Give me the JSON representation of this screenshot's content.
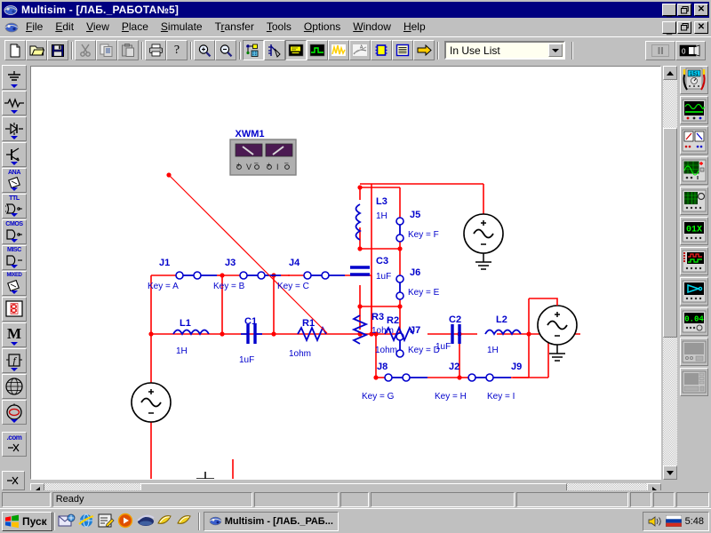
{
  "window": {
    "title": "Multisim - [ЛАБ._РАБОТА№5]",
    "app_icon": "multisim-icon",
    "minimize_label": "_",
    "maximize_label": "❐",
    "close_label": "✕"
  },
  "menubar": {
    "mdi_icon": "mdi-document-icon",
    "items": [
      {
        "label": "File",
        "accel": "F"
      },
      {
        "label": "Edit",
        "accel": "E"
      },
      {
        "label": "View",
        "accel": "V"
      },
      {
        "label": "Place",
        "accel": "P"
      },
      {
        "label": "Simulate",
        "accel": "S"
      },
      {
        "label": "Transfer",
        "accel": "r"
      },
      {
        "label": "Tools",
        "accel": "T"
      },
      {
        "label": "Options",
        "accel": "O"
      },
      {
        "label": "Window",
        "accel": "W"
      },
      {
        "label": "Help",
        "accel": "H"
      }
    ],
    "mdi_buttons": [
      "_",
      "❐",
      "✕"
    ]
  },
  "toolbar": {
    "buttons": [
      {
        "name": "new-file-button",
        "icon": "new-document-icon"
      },
      {
        "name": "open-file-button",
        "icon": "open-folder-icon"
      },
      {
        "name": "save-file-button",
        "icon": "floppy-disk-icon"
      },
      {
        "name": "cut-button",
        "icon": "scissors-icon"
      },
      {
        "name": "copy-button",
        "icon": "copy-icon"
      },
      {
        "name": "paste-button",
        "icon": "clipboard-icon"
      },
      {
        "name": "print-button",
        "icon": "printer-icon"
      },
      {
        "name": "help-button",
        "icon": "question-mark-icon"
      },
      {
        "name": "zoom-in-button",
        "icon": "magnifier-plus-icon"
      },
      {
        "name": "zoom-out-button",
        "icon": "magnifier-minus-icon"
      },
      {
        "name": "component-browser-button",
        "icon": "component-database-icon"
      },
      {
        "name": "netlist-button",
        "icon": "pin-tool-icon"
      },
      {
        "name": "properties-button",
        "icon": "yellow-panel-icon"
      },
      {
        "name": "oscilloscope-button",
        "icon": "green-waveform-icon"
      },
      {
        "name": "analysis-button",
        "icon": "yellow-graph-icon"
      },
      {
        "name": "postprocessor-button",
        "icon": "text-graph-icon"
      },
      {
        "name": "ic-button",
        "icon": "blue-chip-icon"
      },
      {
        "name": "list-button",
        "icon": "yellow-list-icon"
      },
      {
        "name": "transfer-button",
        "icon": "yellow-arrow-icon"
      }
    ],
    "in_use_list": {
      "value": "In Use List",
      "arrow": "▼"
    },
    "pause_button": {
      "name": "pause-simulation-button",
      "icon": "pause-icon"
    },
    "run_button": {
      "name": "run-simulation-button",
      "icon": "power-switch-icon"
    }
  },
  "component_palette": {
    "items": [
      {
        "name": "sources-palette-button",
        "icon": "ground-source-icon",
        "label": ""
      },
      {
        "name": "basic-palette-button",
        "icon": "resistor-icon",
        "label": ""
      },
      {
        "name": "diodes-palette-button",
        "icon": "diode-icon",
        "label": ""
      },
      {
        "name": "transistors-palette-button",
        "icon": "transistor-icon",
        "label": ""
      },
      {
        "name": "analog-palette-button",
        "icon": "opamp-icon",
        "label": "ANA"
      },
      {
        "name": "ttl-palette-button",
        "icon": "logic-gate-icon",
        "label": "TTL"
      },
      {
        "name": "cmos-palette-button",
        "icon": "logic-gate-icon",
        "label": "CMOS"
      },
      {
        "name": "misc-digital-palette-button",
        "icon": "logic-gate-icon",
        "label": "MISC"
      },
      {
        "name": "mixed-palette-button",
        "icon": "mixed-chip-icon",
        "label": "MIXED"
      },
      {
        "name": "indicators-palette-button",
        "icon": "seven-segment-icon",
        "label": ""
      },
      {
        "name": "misc-palette-button",
        "icon": "letter-m-icon",
        "label": ""
      },
      {
        "name": "controls-palette-button",
        "icon": "function-block-icon",
        "label": ""
      },
      {
        "name": "rf-palette-button",
        "icon": "rf-globe-icon",
        "label": ""
      },
      {
        "name": "electromech-palette-button",
        "icon": "motor-icon",
        "label": ""
      },
      {
        "name": "edu-palette-button",
        "icon": "dot-com-icon",
        "label": ".com"
      }
    ]
  },
  "instruments_palette": {
    "items": [
      {
        "name": "multimeter-button",
        "icon": "multimeter-icon"
      },
      {
        "name": "function-generator-button",
        "icon": "function-generator-icon"
      },
      {
        "name": "wattmeter-button",
        "icon": "wattmeter-icon"
      },
      {
        "name": "oscilloscope-instrument-button",
        "icon": "oscilloscope-icon"
      },
      {
        "name": "bode-plotter-button",
        "icon": "bode-plotter-icon"
      },
      {
        "name": "word-generator-button",
        "icon": "word-generator-icon"
      },
      {
        "name": "logic-analyzer-button",
        "icon": "logic-analyzer-icon"
      },
      {
        "name": "logic-converter-button",
        "icon": "logic-converter-icon"
      },
      {
        "name": "distortion-analyzer-button",
        "icon": "distortion-analyzer-icon"
      },
      {
        "name": "spectrum-analyzer-button",
        "icon": "spectrum-analyzer-icon"
      },
      {
        "name": "network-analyzer-button",
        "icon": "network-analyzer-icon"
      }
    ]
  },
  "schematic": {
    "instrument": {
      "label": "XWM1",
      "name": "wattmeter-xwm1",
      "terminal_marks": [
        "+",
        "V",
        "−",
        "+",
        "I",
        "−"
      ]
    },
    "colors": {
      "wire": "#ff0000",
      "component": "#0000cc",
      "label": "#0000cc",
      "outline": "#000000"
    },
    "components": [
      {
        "ref": "L1",
        "value": "1H",
        "type": "inductor"
      },
      {
        "ref": "C1",
        "value": "1uF",
        "type": "capacitor"
      },
      {
        "ref": "R1",
        "value": "1ohm",
        "type": "resistor"
      },
      {
        "ref": "R2",
        "value": "1ohm",
        "type": "resistor"
      },
      {
        "ref": "C2",
        "value": "1uF",
        "type": "capacitor"
      },
      {
        "ref": "L2",
        "value": "1H",
        "type": "inductor"
      },
      {
        "ref": "L3",
        "value": "1H",
        "type": "inductor"
      },
      {
        "ref": "C3",
        "value": "1uF",
        "type": "capacitor"
      },
      {
        "ref": "R3",
        "value": "1ohm",
        "type": "resistor"
      }
    ],
    "switches": [
      {
        "ref": "J1",
        "key": "Key = A"
      },
      {
        "ref": "J3",
        "key": "Key = B"
      },
      {
        "ref": "J4",
        "key": "Key = C"
      },
      {
        "ref": "J7",
        "key": "Key = D"
      },
      {
        "ref": "J6",
        "key": "Key = E"
      },
      {
        "ref": "J5",
        "key": "Key = F"
      },
      {
        "ref": "J8",
        "key": "Key = G"
      },
      {
        "ref": "J2",
        "key": "Key = H"
      },
      {
        "ref": "J9",
        "key": "Key = I"
      }
    ],
    "sources": [
      {
        "name": "ac-source-left",
        "symbol": "~"
      },
      {
        "name": "ac-source-right",
        "symbol": "~"
      },
      {
        "name": "ac-source-top",
        "symbol": "~"
      }
    ],
    "grounds": [
      {
        "name": "ground-left"
      },
      {
        "name": "ground-right"
      },
      {
        "name": "ground-top"
      }
    ]
  },
  "statusbar": {
    "message": "Ready",
    "panels": [
      "",
      "",
      "",
      "",
      "",
      ""
    ]
  },
  "taskbar": {
    "start_label": "Пуск",
    "quick_launch": [
      {
        "name": "outlook-express-icon"
      },
      {
        "name": "internet-explorer-icon"
      },
      {
        "name": "notepad-icon"
      },
      {
        "name": "media-player-icon"
      },
      {
        "name": "winamp-icon"
      },
      {
        "name": "shortcut-icon-1"
      },
      {
        "name": "shortcut-icon-2"
      }
    ],
    "tasks": [
      {
        "label": "Multisim - [ЛАБ._РАБ...",
        "icon": "multisim-icon",
        "active": true
      }
    ],
    "tray": {
      "volume_icon": "speaker-icon",
      "language_icon": "russian-flag-icon",
      "clock": "5:48"
    }
  }
}
